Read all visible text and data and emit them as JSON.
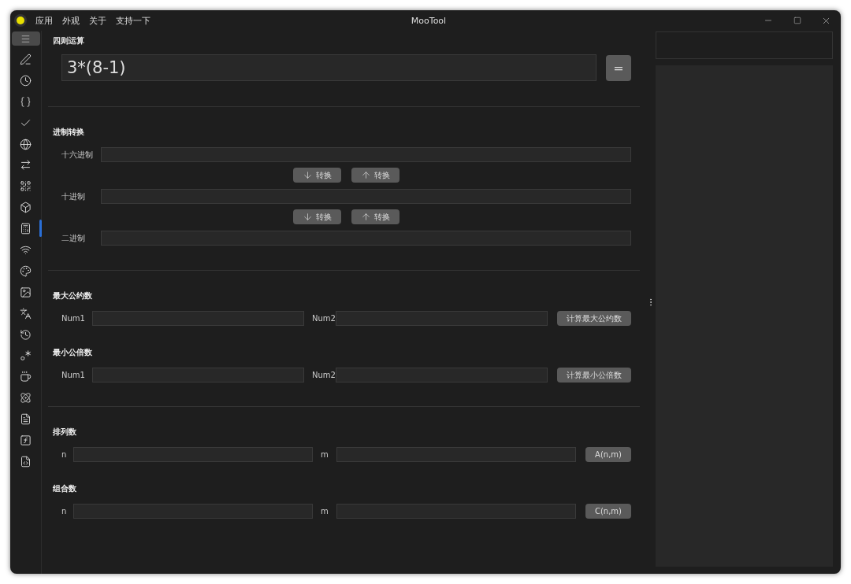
{
  "window": {
    "title": "MooTool"
  },
  "menu": [
    "应用",
    "外观",
    "关于",
    "支持一下"
  ],
  "sidebar": {
    "items": [
      {
        "selected": false
      },
      {
        "selected": false
      },
      {
        "selected": false
      },
      {
        "selected": false
      },
      {
        "selected": false
      },
      {
        "selected": false
      },
      {
        "selected": false
      },
      {
        "selected": false
      },
      {
        "selected": true
      },
      {
        "selected": false
      },
      {
        "selected": false
      },
      {
        "selected": false
      },
      {
        "selected": false
      },
      {
        "selected": false
      },
      {
        "selected": false
      },
      {
        "selected": false
      },
      {
        "selected": false
      },
      {
        "selected": false
      },
      {
        "selected": false
      },
      {
        "selected": false
      }
    ]
  },
  "groups": [
    {
      "sections": [
        {
          "kind": "expression",
          "title": "四则运算",
          "value": "3*(8-1)",
          "button": "="
        }
      ]
    },
    {
      "sections": [
        {
          "kind": "conversion",
          "title": "进制转换",
          "rows": [
            {
              "label": "十六进制",
              "buttons": [
                "转换",
                "转换"
              ]
            },
            {
              "label": "十进制",
              "buttons": [
                "转换",
                "转换"
              ]
            },
            {
              "label": "二进制"
            }
          ]
        }
      ]
    },
    {
      "sections": [
        {
          "kind": "pair",
          "title": "最大公约数",
          "label_1": "Num1",
          "label_2": "Num2",
          "button": "计算最大公约数"
        },
        {
          "kind": "pair",
          "title": "最小公倍数",
          "label_1": "Num1",
          "label_2": "Num2",
          "button": "计算最小公倍数"
        }
      ]
    },
    {
      "sections": [
        {
          "kind": "pair",
          "title": "排列数",
          "label_1": "n",
          "label_2": "m",
          "button": "A(n,m)"
        },
        {
          "kind": "pair",
          "title": "组合数",
          "label_1": "n",
          "label_2": "m",
          "button": "C(n,m)"
        }
      ]
    }
  ]
}
